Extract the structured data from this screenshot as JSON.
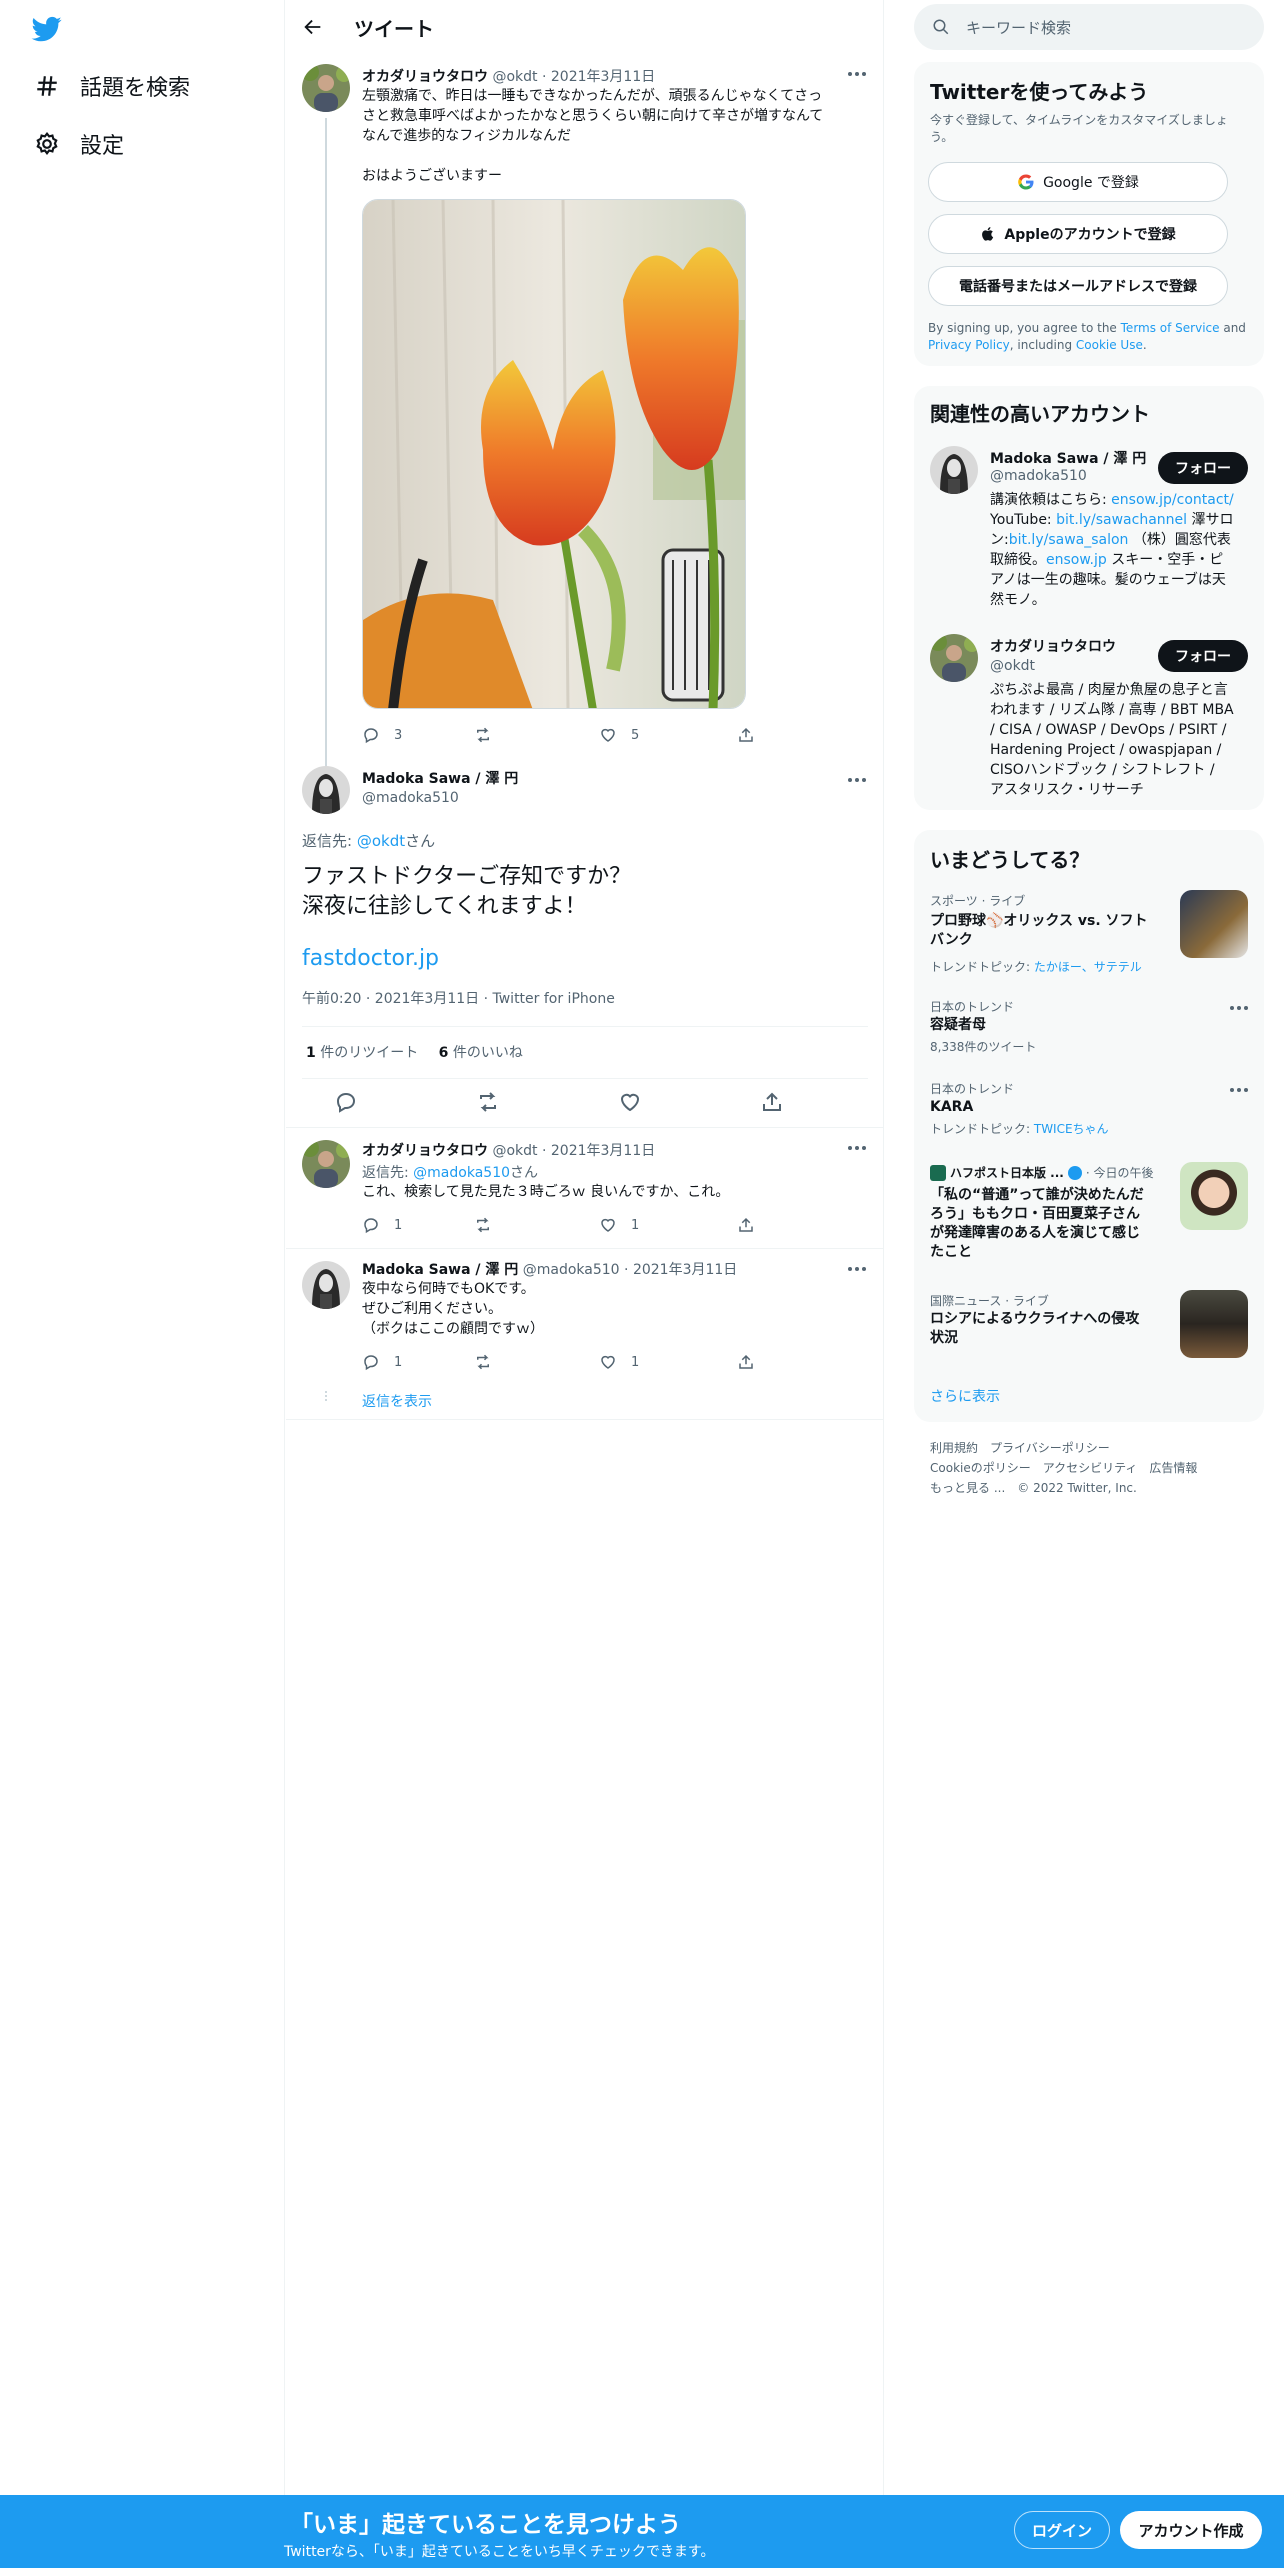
{
  "nav": {
    "explore_label": "話題を検索",
    "settings_label": "設定"
  },
  "header": {
    "title": "ツイート"
  },
  "tweet1": {
    "name": "オカダリョウタロウ",
    "handle": "@okdt",
    "date": "2021年3月11日",
    "text_l1": "左顎激痛で、昨日は一睡もできなかったんだが、頑張るんじゃなくてさっ",
    "text_l2": "さと救急車呼べばよかったかなと思うくらい朝に向けて辛さが増すなんて",
    "text_l3": "なんで進歩的なフィジカルなんだ",
    "text_l4": "おはようございますー",
    "replies": "3",
    "likes": "5"
  },
  "main_tweet": {
    "name": "Madoka Sawa / 澤 円",
    "handle": "@madoka510",
    "reply_to_prefix": "返信先: ",
    "reply_to_handle": "@okdt",
    "reply_to_suffix": "さん",
    "text_l1": "ファストドクターご存知ですか？",
    "text_l2": "深夜に往診してくれますよ！",
    "link": "fastdoctor.jp",
    "timestamp": "午前0:20 · 2021年3月11日 · Twitter for iPhone",
    "retweet_count": "1",
    "retweet_label": " 件のリツイート",
    "like_count": "6",
    "like_label": " 件のいいね"
  },
  "reply1": {
    "name": "オカダリョウタロウ",
    "handle": "@okdt",
    "date": "2021年3月11日",
    "reply_to_prefix": "返信先: ",
    "reply_to_handle": "@madoka510",
    "reply_to_suffix": "さん",
    "text": "これ、検索して見た見た３時ごろｗ 良いんですか、これ。",
    "replies": "1",
    "likes": "1"
  },
  "reply2": {
    "name": "Madoka Sawa / 澤 円",
    "handle": "@madoka510",
    "date": "2021年3月11日",
    "text_l1": "夜中なら何時でもOKです。",
    "text_l2": "ぜひご利用ください。",
    "text_l3": "（ボクはここの顧問ですｗ）",
    "replies": "1",
    "likes": "1",
    "show_replies": "返信を表示"
  },
  "search": {
    "placeholder": "キーワード検索"
  },
  "signup_panel": {
    "title": "Twitterを使ってみよう",
    "subtitle": "今すぐ登録して、タイムラインをカスタマイズしましょう。",
    "google": "Google で登録",
    "apple": "Appleのアカウントで登録",
    "phone": "電話番号またはメールアドレスで登録",
    "legal_1": "By signing up, you agree to the ",
    "legal_tos": "Terms of Service",
    "legal_2": " and ",
    "legal_privacy": "Privacy Policy",
    "legal_3": ", including ",
    "legal_cookie": "Cookie Use",
    "legal_4": "."
  },
  "related": {
    "title": "関連性の高いアカウント",
    "follow": "フォロー",
    "acc1": {
      "name": "Madoka Sawa / 澤 円",
      "handle": "@madoka510",
      "bio_a": "講演依頼はこちら: ",
      "bio_link1": "ensow.jp/contact/",
      "bio_b": "YouTube: ",
      "bio_link2": "bit.ly/sawachannel",
      "bio_c": " 澤サロ",
      "bio_d": "ン:",
      "bio_link3": "bit.ly/sawa_salon",
      "bio_e": " （株）圓窓代表",
      "bio_f": "取締役。",
      "bio_link4": "ensow.jp",
      "bio_g": " スキー・空手・ピ",
      "bio_h": "アノは一生の趣味。髪のウェーブは天",
      "bio_i": "然モノ。"
    },
    "acc2": {
      "name": "オカダリョウタロウ",
      "handle": "@okdt",
      "bio_l1": "ぷちぷよ最高 / 肉屋か魚屋の息子と言",
      "bio_l2": "われます / リズム隊 / 高専 / BBT MBA",
      "bio_l3": "/ CISA / OWASP / DevOps / PSIRT /",
      "bio_l4": "Hardening Project / owaspjapan /",
      "bio_l5": "CISOハンドブック / シフトレフト /",
      "bio_l6": "アスタリスク・リサーチ"
    }
  },
  "trends": {
    "title": "いまどうしてる？",
    "t1_cat": "スポーツ · ライブ",
    "t1_title_l1": "プロ野球⚾️オリックス vs. ソフト",
    "t1_title_l2": "バンク",
    "t1_sub_prefix": "トレンドトピック: ",
    "t1_sub_links": "たかほー、サテテル",
    "t2_cat": "日本のトレンド",
    "t2_title": "容疑者母",
    "t2_sub": "8,338件のツイート",
    "t3_cat": "日本のトレンド",
    "t3_title": "KARA",
    "t3_sub_prefix": "トレンドトピック: ",
    "t3_sub_link": "TWICEちゃん",
    "t4_source": "ハフポスト日本版 ...",
    "t4_time": " · 今日の午後",
    "t4_l1": "「私の“普通”って誰が決めたんだ",
    "t4_l2": "ろう」ももクロ・百田夏菜子さん",
    "t4_l3": "が発達障害のある人を演じて感じ",
    "t4_l4": "たこと",
    "t5_cat": "国際ニュース · ライブ",
    "t5_l1": "ロシアによるウクライナへの侵攻",
    "t5_l2": "状況",
    "show_more": "さらに表示"
  },
  "footer": {
    "terms": "利用規約",
    "privacy": "プライバシーポリシー",
    "cookie": "Cookieのポリシー",
    "accessibility": "アクセシビリティ",
    "ads": "広告情報",
    "more": "もっと見る ...",
    "copyright": "© 2022 Twitter, Inc."
  },
  "bottom_bar": {
    "title": "「いま」起きていることを見つけよう",
    "subtitle": "Twitterなら、「いま」起きていることをいち早くチェックできます。",
    "login": "ログイン",
    "signup": "アカウント作成"
  },
  "colors": {
    "accent": "#1d9bf0",
    "text": "#0f1419",
    "muted": "#536471"
  }
}
